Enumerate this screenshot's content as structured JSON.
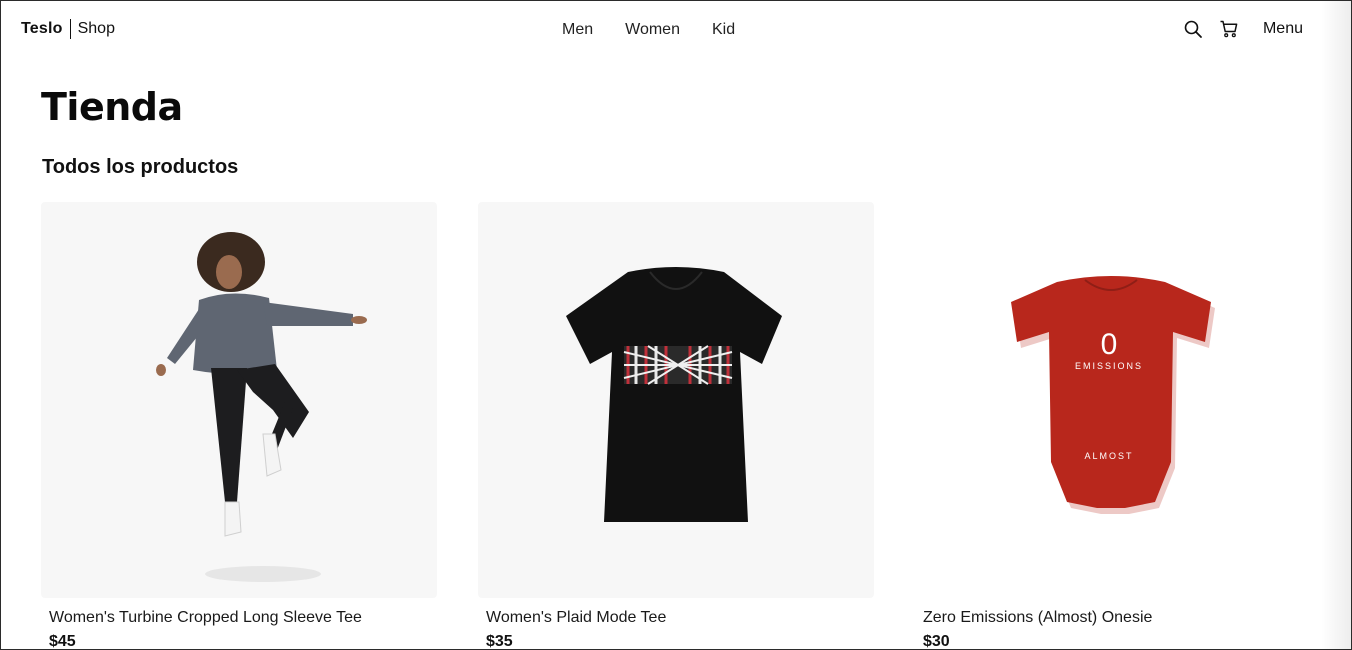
{
  "header": {
    "brand_name": "Teslo",
    "brand_sub": "Shop",
    "nav": [
      {
        "label": "Men"
      },
      {
        "label": "Women"
      },
      {
        "label": "Kid"
      }
    ],
    "menu_label": "Menu",
    "icons": [
      "search-icon",
      "cart-icon"
    ]
  },
  "page": {
    "title": "Tienda",
    "subtitle": "Todos los productos"
  },
  "products": [
    {
      "title": "Women's Turbine Cropped Long Sleeve Tee",
      "price": "$45",
      "image": "woman-jumping-gray-sweater"
    },
    {
      "title": "Women's Plaid Mode Tee",
      "price": "$35",
      "image": "black-tshirt-plaid-print"
    },
    {
      "title": "Zero Emissions (Almost) Onesie",
      "price": "$30",
      "image": "red-baby-onesie",
      "image_text_big": "0",
      "image_text_mid": "EMISSIONS",
      "image_text_low": "ALMOST"
    }
  ],
  "colors": {
    "card_bg": "#f7f7f7",
    "onesie_red": "#b8271c",
    "tee_black": "#111111",
    "sweater_gray": "#5f6672"
  }
}
